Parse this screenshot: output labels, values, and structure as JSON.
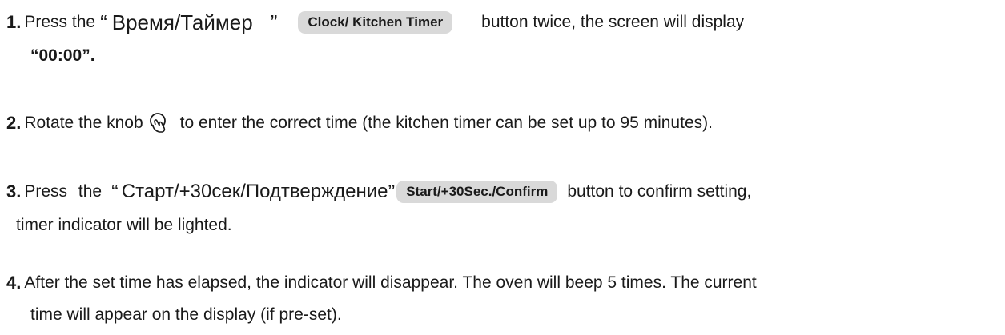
{
  "steps": [
    {
      "number": "1.",
      "press": "Press the",
      "quote_open": "“",
      "cyrillic_label": "Время/Таймер",
      "quote_close": "”",
      "button": "Clock/ Kitchen Timer",
      "rest": "button twice, the screen will display",
      "display_value": "“00:00”."
    },
    {
      "number": "2.",
      "before_icon": "Rotate the knob",
      "icon": "knob-icon",
      "after_icon": "to enter the correct time (the kitchen timer can be set up to 95 minutes)."
    },
    {
      "number": "3.",
      "press": "Press the",
      "quote_open": "“",
      "cyrillic_label": "Старт/+30сек/Подтверждение",
      "quote_close": "”",
      "button": "Start/+30Sec./Confirm",
      "rest": "button to confirm setting,",
      "continuation": "timer indicator will be lighted."
    },
    {
      "number": "4.",
      "text": "After the set time has elapsed, the indicator will disappear. The oven will beep 5 times. The current",
      "continuation": "time will appear on the display (if pre-set)."
    }
  ],
  "colors": {
    "button_bg": "#d9d9d9",
    "text": "#1a1a1a"
  }
}
